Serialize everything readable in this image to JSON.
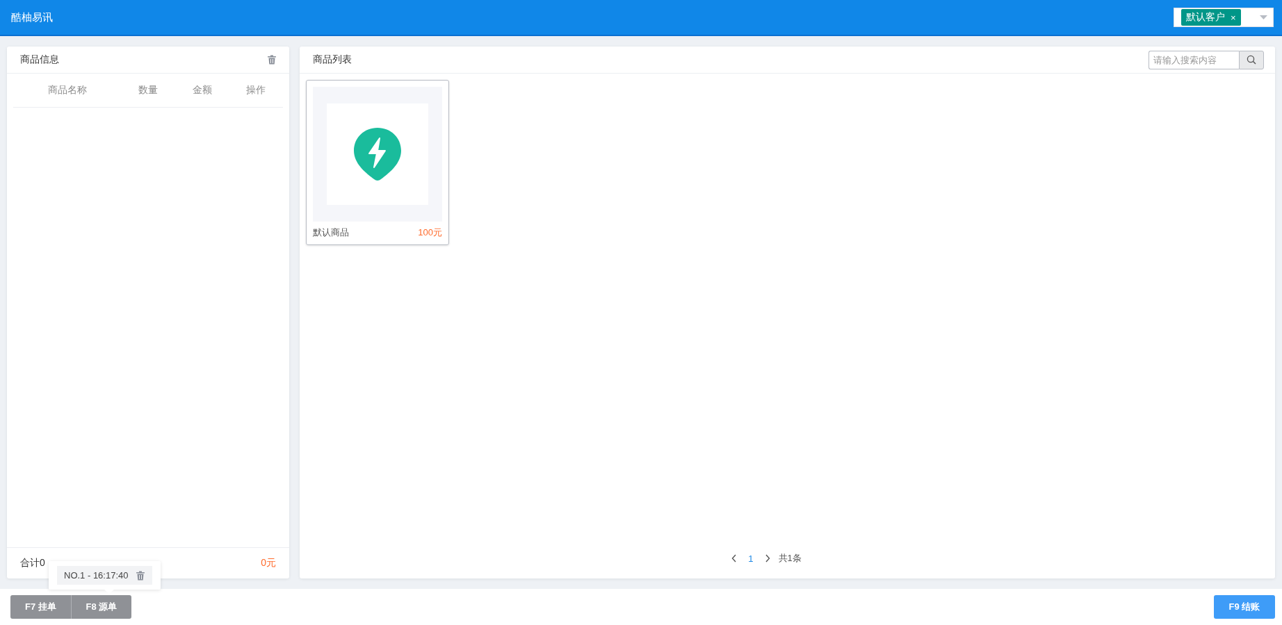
{
  "app": {
    "title": "酷柚易讯"
  },
  "customer_select": {
    "tags": [
      {
        "label": "默认客户",
        "remove": "×"
      }
    ]
  },
  "cart": {
    "title": "商品信息",
    "columns": [
      "商品名称",
      "数量",
      "金额",
      "操作"
    ],
    "total_label": "合计0",
    "total_amount": "0元"
  },
  "goods": {
    "title": "商品列表",
    "search": {
      "placeholder": "请输入搜索内容"
    },
    "items": [
      {
        "name": "默认商品",
        "price": "100元"
      }
    ],
    "pagination": {
      "pages": [
        {
          "label": "1",
          "selected": true
        }
      ],
      "total": "共1条"
    }
  },
  "held_orders": [
    {
      "label": "NO.1 - 16:17:40"
    }
  ],
  "buttons": {
    "left": [
      "F7 挂单",
      "F8 源单"
    ],
    "right": "F9 结账"
  }
}
